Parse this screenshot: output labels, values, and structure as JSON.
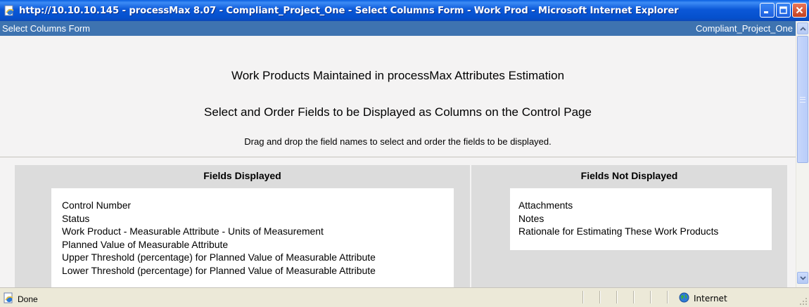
{
  "window": {
    "title": "http://10.10.10.145 - processMax 8.07 - Compliant_Project_One - Select Columns Form - Work Prod - Microsoft Internet Explorer",
    "app_icon": "ie-page-icon",
    "controls": [
      "minimize-icon",
      "maximize-icon",
      "close-icon"
    ]
  },
  "formbar": {
    "form_name": "Select Columns Form",
    "project_name": "Compliant_Project_One"
  },
  "page": {
    "heading": "Work Products Maintained in processMax Attributes Estimation",
    "subheading": "Select and Order Fields to be Displayed as Columns on the Control Page",
    "instructions": "Drag and drop the field names to select and order the fields to be displayed."
  },
  "panels": {
    "displayed": {
      "header": "Fields Displayed",
      "fields": [
        "Control Number",
        "Status",
        "Work Product - Measurable Attribute - Units of Measurement",
        "Planned Value of Measurable Attribute",
        "Upper Threshold (percentage) for Planned Value of Measurable Attribute",
        "Lower Threshold (percentage) for Planned Value of Measurable Attribute"
      ]
    },
    "not_displayed": {
      "header": "Fields Not Displayed",
      "fields": [
        "Attachments",
        "Notes",
        "Rationale for Estimating These Work Products"
      ]
    }
  },
  "statusbar": {
    "status_text": "Done",
    "zone_text": "Internet",
    "status_icon": "page-done-icon",
    "zone_icon": "globe-icon"
  },
  "colors": {
    "titlebar": "#0550cc",
    "formbar": "#3e73b0",
    "panel": "#dcdcdc",
    "content_bg": "#f4f3f3",
    "statusbar": "#ece9d8"
  }
}
